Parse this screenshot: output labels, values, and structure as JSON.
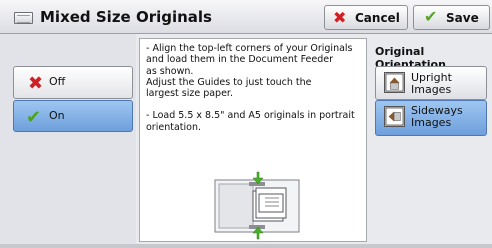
{
  "header": {
    "title": "Mixed Size Originals",
    "cancel_label": "Cancel",
    "save_label": "Save",
    "icons": {
      "title": "document-stack-icon",
      "cancel": "red-x-icon",
      "save": "green-check-icon"
    }
  },
  "options": [
    {
      "label": "Off",
      "icon": "red-x-icon",
      "selected": false
    },
    {
      "label": "On",
      "icon": "green-check-icon",
      "selected": true
    }
  ],
  "instructions": {
    "paragraph1": "- Align the top-left corners of your Originals\n  and load them in the Document Feeder\n  as shown.\n  Adjust the Guides to just touch the\n  largest size paper.",
    "paragraph2": "- Load 5.5 x 8.5\" and A5 originals in portrait\n  orientation.",
    "illustration": "document-feeder-guides-illustration"
  },
  "orientation": {
    "title": "Original Orientation",
    "options": [
      {
        "label": "Upright Images",
        "icon": "upright-image-icon",
        "selected": false
      },
      {
        "label": "Sideways\nImages",
        "icon": "sideways-image-icon",
        "selected": true
      }
    ]
  },
  "colors": {
    "selected": "#7aaae6",
    "cancel_x": "#d11e22",
    "check": "#53a91e",
    "guide_arrow": "#4caf2a"
  }
}
